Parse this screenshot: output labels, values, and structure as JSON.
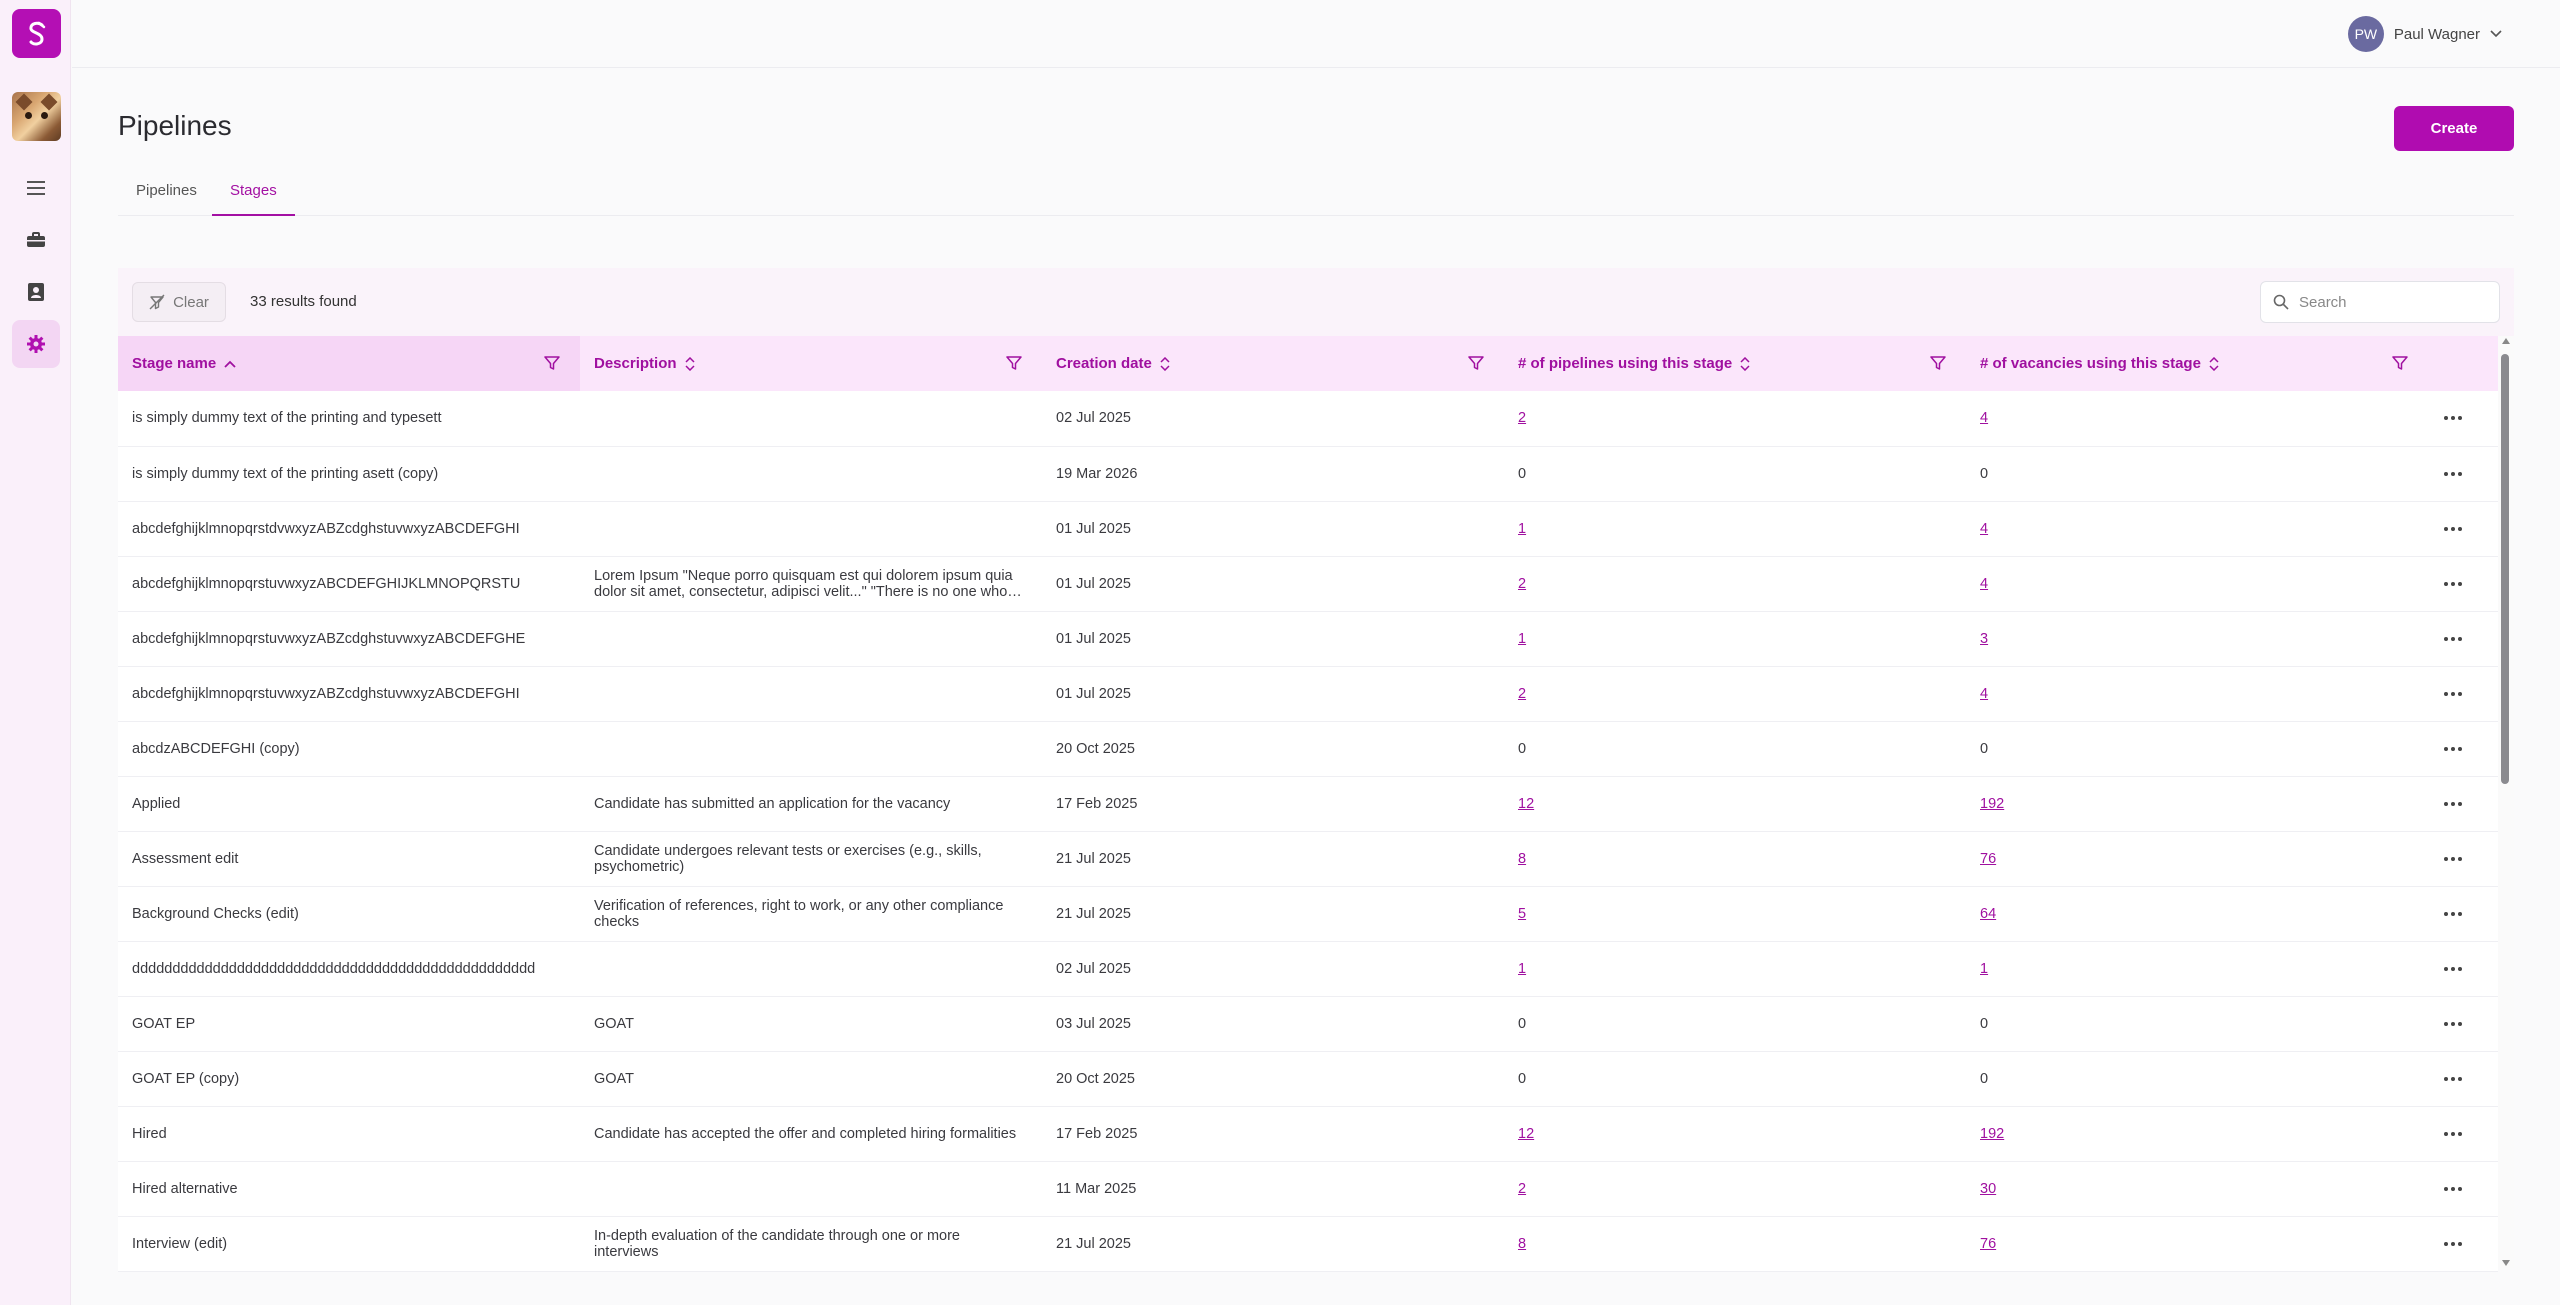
{
  "app": {
    "logo_letter": "S"
  },
  "user": {
    "initials": "PW",
    "name": "Paul Wagner"
  },
  "page": {
    "title": "Pipelines",
    "create_label": "Create"
  },
  "tabs": [
    {
      "label": "Pipelines",
      "active": false
    },
    {
      "label": "Stages",
      "active": true
    }
  ],
  "toolbar": {
    "clear_label": "Clear",
    "results_text": "33 results found",
    "search_placeholder": "Search"
  },
  "table": {
    "columns": [
      {
        "label": "Stage name",
        "sort": "asc"
      },
      {
        "label": "Description",
        "sort": "none"
      },
      {
        "label": "Creation date",
        "sort": "none"
      },
      {
        "label": "# of pipelines using this stage",
        "sort": "none"
      },
      {
        "label": "# of vacancies using this stage",
        "sort": "none"
      }
    ],
    "rows": [
      {
        "name": "is simply dummy text of the printing and typesett",
        "description": "",
        "date": "02 Jul 2025",
        "pipelines": "2",
        "vacancies": "4"
      },
      {
        "name": "is simply dummy text of the printing asett (copy)",
        "description": "",
        "date": "19 Mar 2026",
        "pipelines": "0",
        "vacancies": "0"
      },
      {
        "name": "abcdefghijklmnopqrstdvwxyzABZcdghstuvwxyzABCDEFGHI",
        "description": "",
        "date": "01 Jul 2025",
        "pipelines": "1",
        "vacancies": "4"
      },
      {
        "name": "abcdefghijklmnopqrstuvwxyzABCDEFGHIJKLMNOPQRSTU",
        "description": "Lorem Ipsum \"Neque porro quisquam est qui dolorem ipsum quia dolor sit amet, consectetur, adipisci velit...\" \"There is no one who loves pain itself\"",
        "date": "01 Jul 2025",
        "pipelines": "2",
        "vacancies": "4"
      },
      {
        "name": "abcdefghijklmnopqrstuvwxyzABZcdghstuvwxyzABCDEFGHE",
        "description": "",
        "date": "01 Jul 2025",
        "pipelines": "1",
        "vacancies": "3"
      },
      {
        "name": "abcdefghijklmnopqrstuvwxyzABZcdghstuvwxyzABCDEFGHI",
        "description": "",
        "date": "01 Jul 2025",
        "pipelines": "2",
        "vacancies": "4"
      },
      {
        "name": "abcdzABCDEFGHI (copy)",
        "description": "",
        "date": "20 Oct 2025",
        "pipelines": "0",
        "vacancies": "0"
      },
      {
        "name": "Applied",
        "description": "Candidate has submitted an application for the vacancy",
        "date": "17 Feb 2025",
        "pipelines": "12",
        "vacancies": "192"
      },
      {
        "name": "Assessment edit",
        "description": "Candidate undergoes relevant tests or exercises (e.g., skills, psychometric)",
        "date": "21 Jul 2025",
        "pipelines": "8",
        "vacancies": "76"
      },
      {
        "name": "Background Checks (edit)",
        "description": "Verification of references, right to work, or any other compliance checks",
        "date": "21 Jul 2025",
        "pipelines": "5",
        "vacancies": "64"
      },
      {
        "name": "dddddddddddddddddddddddddddddddddddddddddddddddddd",
        "description": "",
        "date": "02 Jul 2025",
        "pipelines": "1",
        "vacancies": "1"
      },
      {
        "name": "GOAT EP",
        "description": "GOAT",
        "date": "03 Jul 2025",
        "pipelines": "0",
        "vacancies": "0"
      },
      {
        "name": "GOAT EP (copy)",
        "description": "GOAT",
        "date": "20 Oct 2025",
        "pipelines": "0",
        "vacancies": "0"
      },
      {
        "name": "Hired",
        "description": "Candidate has accepted the offer and completed hiring formalities",
        "date": "17 Feb 2025",
        "pipelines": "12",
        "vacancies": "192"
      },
      {
        "name": "Hired alternative",
        "description": "",
        "date": "11 Mar 2025",
        "pipelines": "2",
        "vacancies": "30"
      },
      {
        "name": "Interview (edit)",
        "description": "In-depth evaluation of the candidate through one or more interviews",
        "date": "21 Jul 2025",
        "pipelines": "8",
        "vacancies": "76"
      }
    ]
  },
  "colors": {
    "accent": "#a010a0",
    "brand": "#b40fb4",
    "header_bg": "#fbe6fb"
  }
}
